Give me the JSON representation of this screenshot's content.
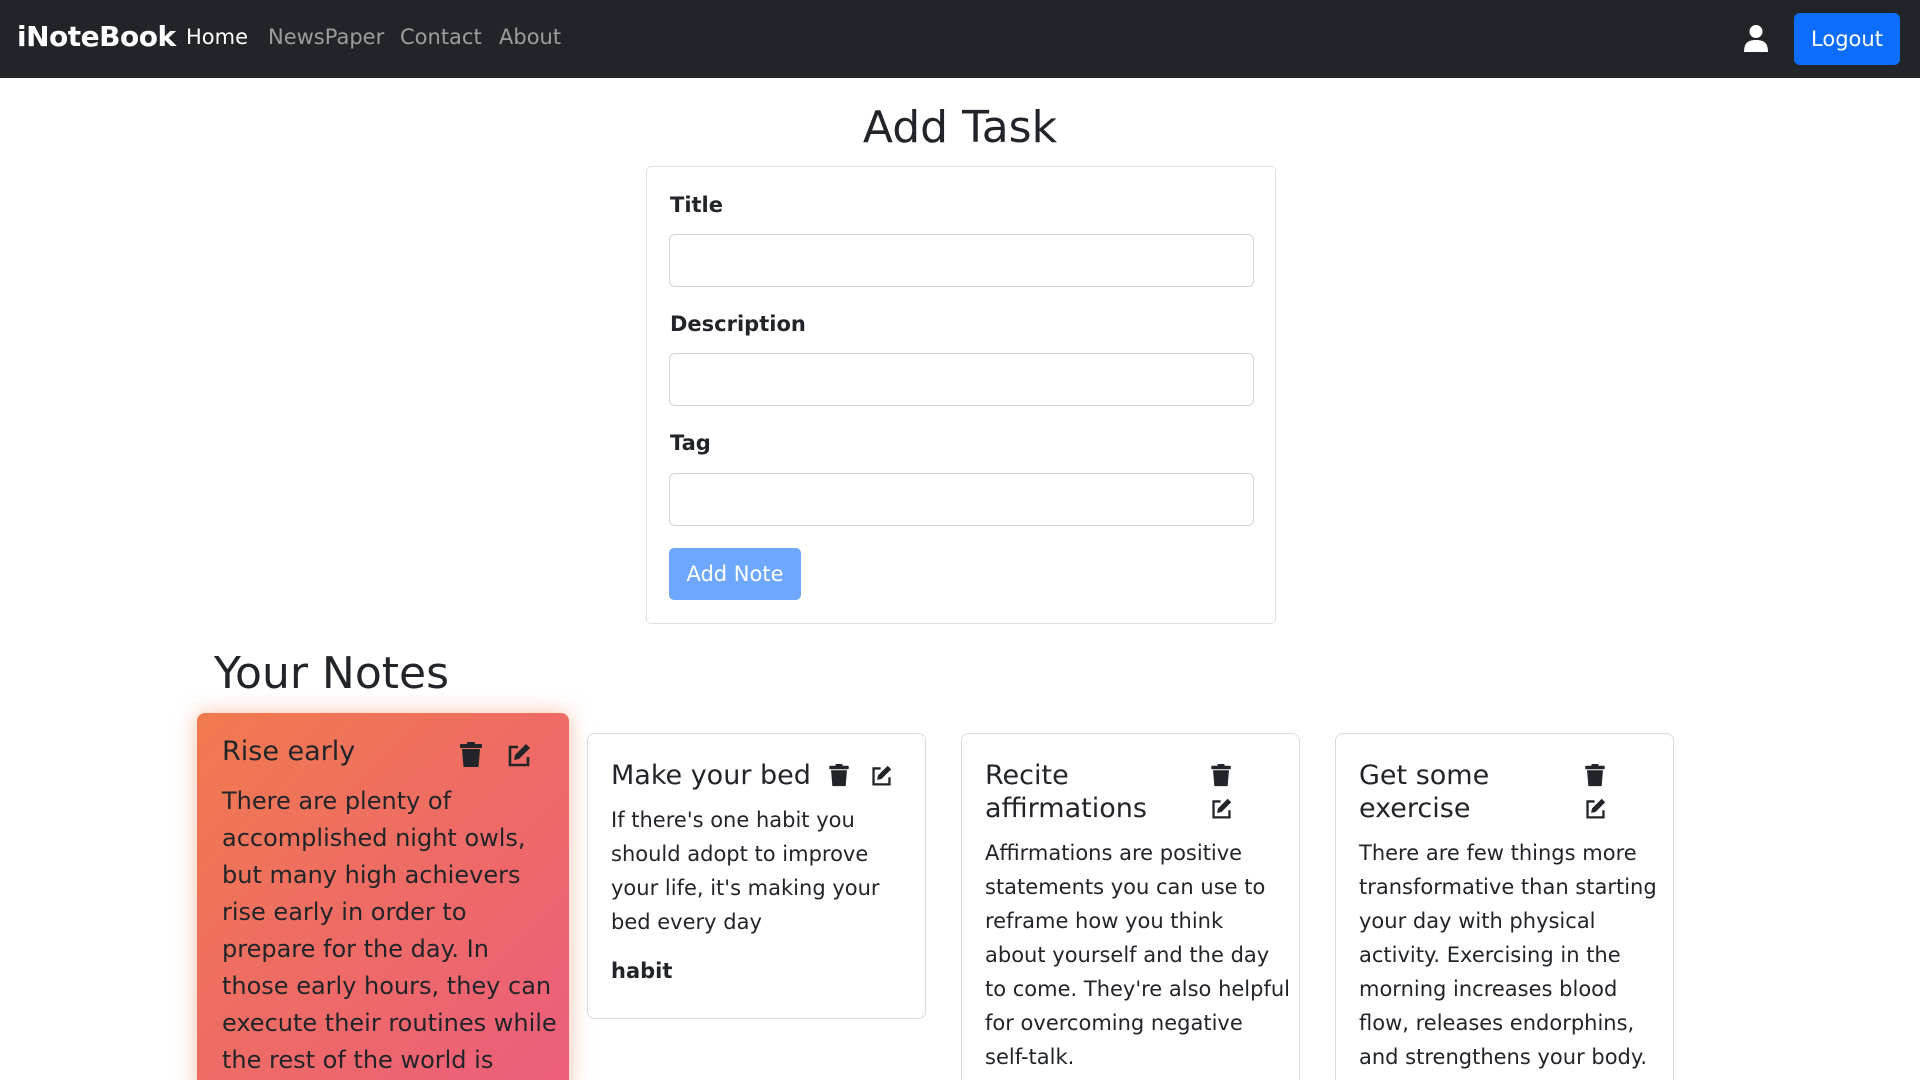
{
  "navbar": {
    "brand": "iNoteBook",
    "links": [
      "Home",
      "NewsPaper",
      "Contact",
      "About"
    ],
    "logout_label": "Logout"
  },
  "form": {
    "heading": "Add Task",
    "title_label": "Title",
    "title_value": "",
    "description_label": "Description",
    "description_value": "",
    "tag_label": "Tag",
    "tag_value": "",
    "submit_label": "Add Note"
  },
  "notes": {
    "heading": "Your Notes",
    "items": [
      {
        "title": "Rise early",
        "description": "There are plenty of accomplished night owls, but many high achievers rise early in order to prepare for the day. In those early hours, they can execute their routines while the rest of the world is asleep.",
        "tag": ""
      },
      {
        "title": "Make your bed",
        "description": "If there's one habit you should adopt to improve your life, it's making your bed every day",
        "tag": "habit"
      },
      {
        "title": "Recite affirmations",
        "description": "Affirmations are positive statements you can use to reframe how you think about yourself and the day to come. They're also helpful for overcoming negative self-talk.",
        "tag": ""
      },
      {
        "title": "Get some exercise",
        "description": "There are few things more transformative than starting your day with physical activity. Exercising in the morning increases blood flow, releases endorphins, and strengthens your body. It",
        "tag": ""
      }
    ]
  },
  "icons": {
    "user": "user-icon",
    "delete": "trash-icon",
    "edit": "edit-icon"
  },
  "colors": {
    "navbar_bg": "#212529",
    "primary": "#0d6efd",
    "highlight_gradient_start": "#f07a4e",
    "highlight_gradient_end": "#ec5d7c"
  }
}
